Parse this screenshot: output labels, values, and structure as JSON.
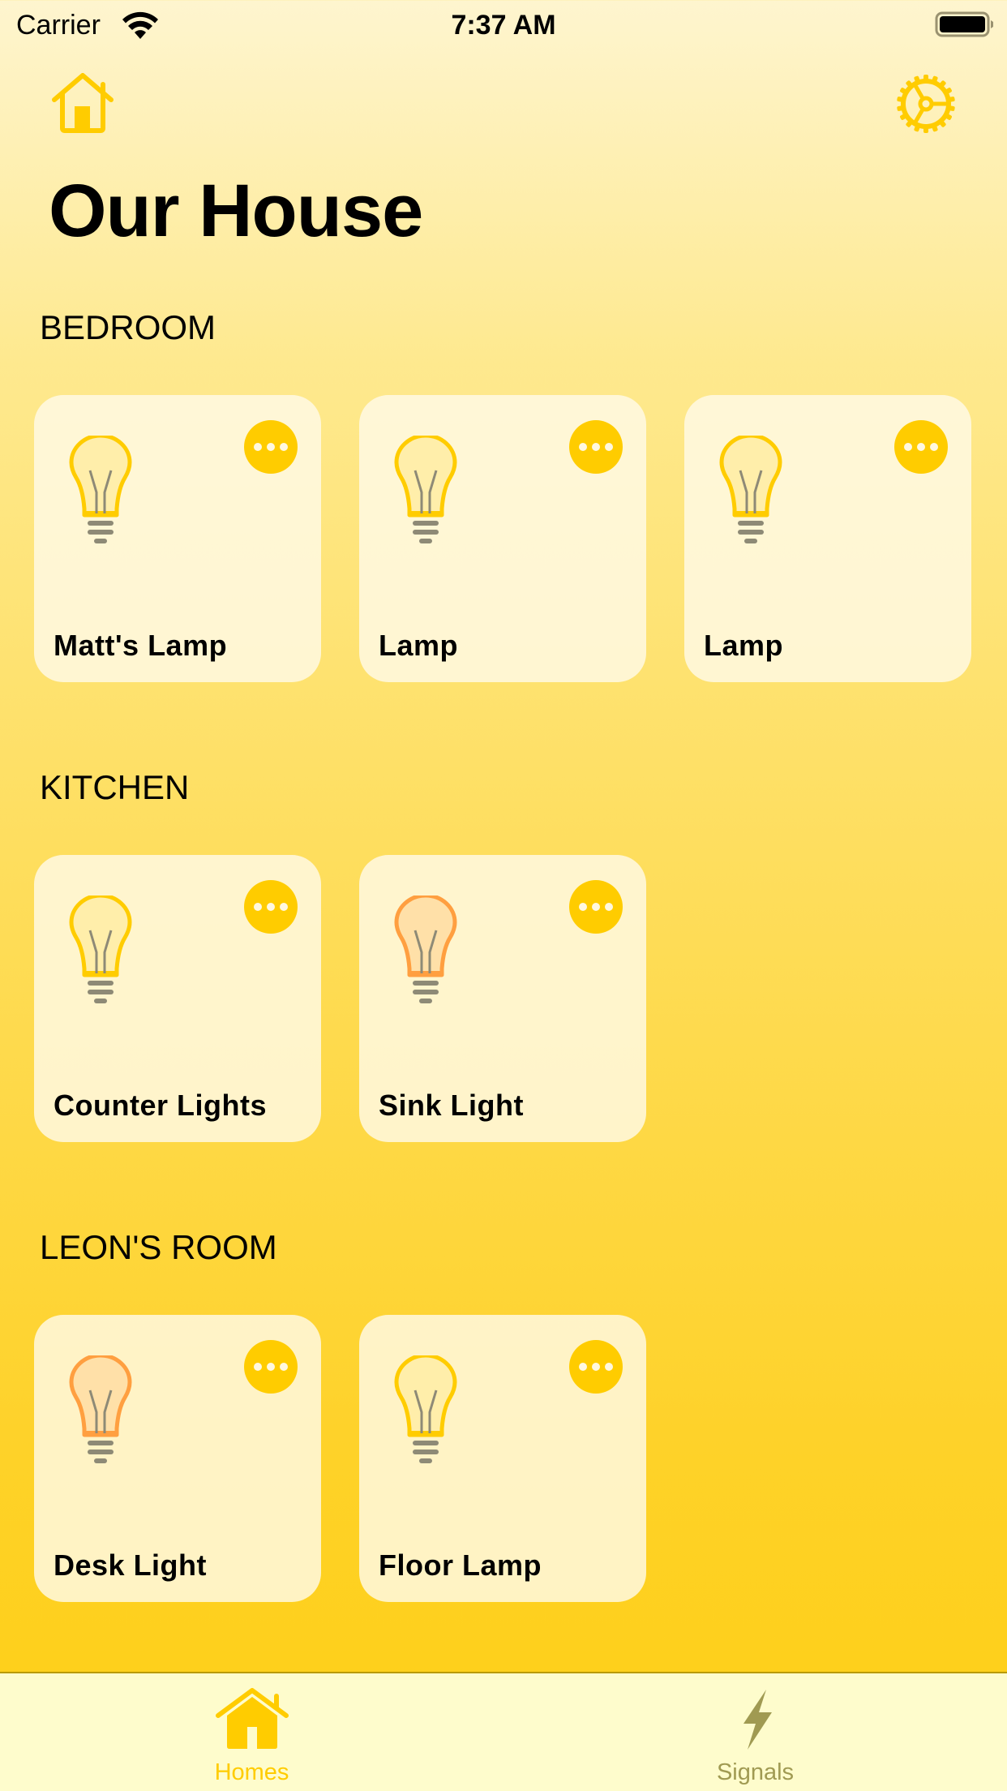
{
  "status_bar": {
    "carrier": "Carrier",
    "time": "7:37 AM",
    "wifi_icon": "wifi-icon",
    "battery_icon": "battery-full-icon"
  },
  "header": {
    "home_icon": "house-icon",
    "settings_icon": "gear-icon",
    "title": "Our House"
  },
  "colors": {
    "accent": "#ffcc00",
    "bulb_yellow": "#ffcc00",
    "bulb_orange": "#ff9f40",
    "tab_inactive": "#a09a52"
  },
  "sections": [
    {
      "title": "BEDROOM",
      "devices": [
        {
          "name": "Matt's Lamp",
          "bulb_color": "yellow"
        },
        {
          "name": "Lamp",
          "bulb_color": "yellow"
        },
        {
          "name": "Lamp",
          "bulb_color": "yellow"
        }
      ]
    },
    {
      "title": "KITCHEN",
      "devices": [
        {
          "name": "Counter Lights",
          "bulb_color": "yellow"
        },
        {
          "name": "Sink Light",
          "bulb_color": "orange"
        }
      ]
    },
    {
      "title": "LEON'S ROOM",
      "devices": [
        {
          "name": "Desk Light",
          "bulb_color": "orange"
        },
        {
          "name": "Floor Lamp",
          "bulb_color": "yellow"
        }
      ]
    }
  ],
  "tab_bar": {
    "tabs": [
      {
        "label": "Homes",
        "icon": "house-fill-icon",
        "selected": true
      },
      {
        "label": "Signals",
        "icon": "bolt-icon",
        "selected": false
      }
    ]
  }
}
